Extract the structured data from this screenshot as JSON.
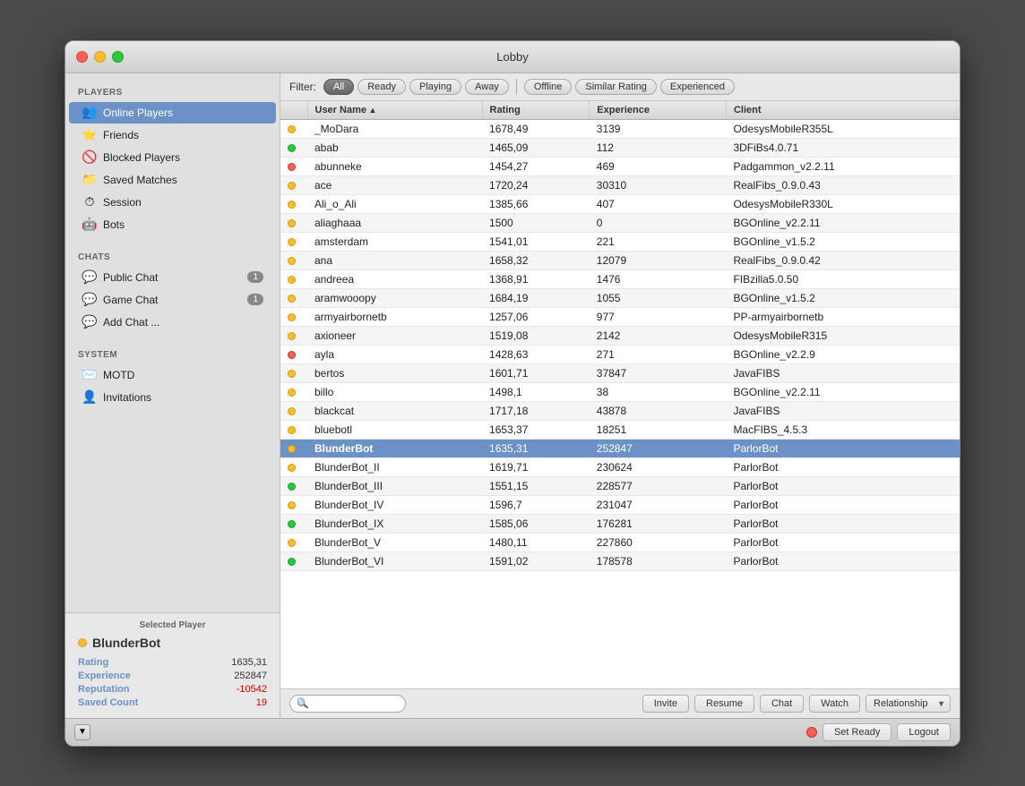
{
  "window": {
    "title": "Lobby"
  },
  "sidebar": {
    "players_header": "PLAYERS",
    "players_items": [
      {
        "id": "online-players",
        "label": "Online Players",
        "icon": "👥",
        "active": true
      },
      {
        "id": "friends",
        "label": "Friends",
        "icon": "⭐"
      },
      {
        "id": "blocked-players",
        "label": "Blocked Players",
        "icon": "🚫"
      },
      {
        "id": "saved-matches",
        "label": "Saved Matches",
        "icon": "📁"
      },
      {
        "id": "session",
        "label": "Session",
        "icon": "⏱"
      },
      {
        "id": "bots",
        "label": "Bots",
        "icon": "🤖"
      }
    ],
    "chats_header": "CHATS",
    "chats_items": [
      {
        "id": "public-chat",
        "label": "Public Chat",
        "badge": "1"
      },
      {
        "id": "game-chat",
        "label": "Game Chat",
        "badge": "1"
      },
      {
        "id": "add-chat",
        "label": "Add Chat ..."
      }
    ],
    "system_header": "SYSTEM",
    "system_items": [
      {
        "id": "motd",
        "label": "MOTD",
        "icon": "✉️"
      },
      {
        "id": "invitations",
        "label": "Invitations",
        "icon": "👤"
      }
    ],
    "selected_player_title": "Selected Player",
    "selected_player": {
      "name": "BlunderBot",
      "dot_color": "#ffbd2e",
      "rating_label": "Rating",
      "rating_value": "1635,31",
      "experience_label": "Experience",
      "experience_value": "252847",
      "reputation_label": "Reputation",
      "reputation_value": "-10542",
      "saved_count_label": "Saved Count",
      "saved_count_value": "19"
    }
  },
  "filter_bar": {
    "label": "Filter:",
    "buttons": [
      {
        "id": "all",
        "label": "All",
        "active": true
      },
      {
        "id": "ready",
        "label": "Ready"
      },
      {
        "id": "playing",
        "label": "Playing"
      },
      {
        "id": "away",
        "label": "Away"
      },
      {
        "id": "offline",
        "label": "Offline"
      },
      {
        "id": "similar-rating",
        "label": "Similar Rating"
      },
      {
        "id": "experienced",
        "label": "Experienced"
      }
    ]
  },
  "table": {
    "columns": [
      {
        "id": "username",
        "label": "User Name",
        "sorted": true
      },
      {
        "id": "rating",
        "label": "Rating"
      },
      {
        "id": "experience",
        "label": "Experience"
      },
      {
        "id": "client",
        "label": "Client"
      }
    ],
    "rows": [
      {
        "name": "_MoDara",
        "dot": "yellow",
        "rating": "1678,49",
        "experience": "3139",
        "client": "OdesysMobileR355L"
      },
      {
        "name": "abab",
        "dot": "green",
        "rating": "1465,09",
        "experience": "112",
        "client": "3DFiBs4.0.71"
      },
      {
        "name": "abunneke",
        "dot": "red",
        "rating": "1454,27",
        "experience": "469",
        "client": "Padgammon_v2.2.11"
      },
      {
        "name": "ace",
        "dot": "yellow",
        "rating": "1720,24",
        "experience": "30310",
        "client": "RealFibs_0.9.0.43"
      },
      {
        "name": "Ali_o_Ali",
        "dot": "yellow",
        "rating": "1385,66",
        "experience": "407",
        "client": "OdesysMobileR330L"
      },
      {
        "name": "aliaghaaa",
        "dot": "yellow",
        "rating": "1500",
        "experience": "0",
        "client": "BGOnline_v2.2.11"
      },
      {
        "name": "amsterdam",
        "dot": "yellow",
        "rating": "1541,01",
        "experience": "221",
        "client": "BGOnline_v1.5.2"
      },
      {
        "name": "ana",
        "dot": "yellow",
        "rating": "1658,32",
        "experience": "12079",
        "client": "RealFibs_0.9.0.42"
      },
      {
        "name": "andreea",
        "dot": "yellow",
        "rating": "1368,91",
        "experience": "1476",
        "client": "FIBzilla5.0.50"
      },
      {
        "name": "aramwooopy",
        "dot": "yellow",
        "rating": "1684,19",
        "experience": "1055",
        "client": "BGOnline_v1.5.2"
      },
      {
        "name": "armyairbornetb",
        "dot": "yellow",
        "rating": "1257,06",
        "experience": "977",
        "client": "PP-armyairbornetb"
      },
      {
        "name": "axioneer",
        "dot": "yellow",
        "rating": "1519,08",
        "experience": "2142",
        "client": "OdesysMobileR315"
      },
      {
        "name": "ayla",
        "dot": "red",
        "rating": "1428,63",
        "experience": "271",
        "client": "BGOnline_v2.2.9"
      },
      {
        "name": "bertos",
        "dot": "yellow",
        "rating": "1601,71",
        "experience": "37847",
        "client": "JavaFIBS"
      },
      {
        "name": "billo",
        "dot": "yellow",
        "rating": "1498,1",
        "experience": "38",
        "client": "BGOnline_v2.2.11"
      },
      {
        "name": "blackcat",
        "dot": "yellow",
        "rating": "1717,18",
        "experience": "43878",
        "client": "JavaFIBS"
      },
      {
        "name": "bluebotl",
        "dot": "yellow",
        "rating": "1653,37",
        "experience": "18251",
        "client": "MacFIBS_4.5.3"
      },
      {
        "name": "BlunderBot",
        "dot": "yellow",
        "rating": "1635,31",
        "experience": "252847",
        "client": "ParlorBot",
        "selected": true
      },
      {
        "name": "BlunderBot_II",
        "dot": "yellow",
        "rating": "1619,71",
        "experience": "230624",
        "client": "ParlorBot"
      },
      {
        "name": "BlunderBot_III",
        "dot": "green",
        "rating": "1551,15",
        "experience": "228577",
        "client": "ParlorBot"
      },
      {
        "name": "BlunderBot_IV",
        "dot": "yellow",
        "rating": "1596,7",
        "experience": "231047",
        "client": "ParlorBot"
      },
      {
        "name": "BlunderBot_IX",
        "dot": "green",
        "rating": "1585,06",
        "experience": "176281",
        "client": "ParlorBot"
      },
      {
        "name": "BlunderBot_V",
        "dot": "yellow",
        "rating": "1480,11",
        "experience": "227860",
        "client": "ParlorBot"
      },
      {
        "name": "BlunderBot_VI",
        "dot": "green",
        "rating": "1591,02",
        "experience": "178578",
        "client": "ParlorBot"
      }
    ]
  },
  "bottom_bar": {
    "search_placeholder": "",
    "invite_label": "Invite",
    "resume_label": "Resume",
    "chat_label": "Chat",
    "watch_label": "Watch",
    "relationship_label": "Relationship"
  },
  "status_bar": {
    "expand_icon": "▼",
    "set_ready_label": "Set Ready",
    "logout_label": "Logout"
  }
}
